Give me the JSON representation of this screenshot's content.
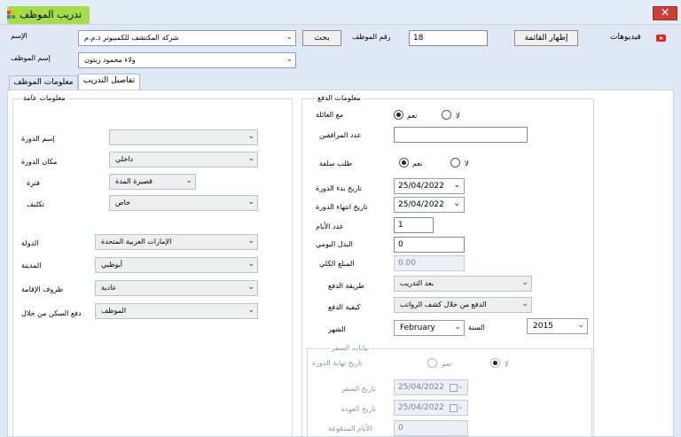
{
  "window": {
    "title": "تدريب الموظف",
    "close_label": "✕"
  },
  "header": {
    "name_label": "الإسم",
    "company_value": "شركة المكتشف للكمبيوتر ذ.م.م",
    "search_label": "بحث",
    "employee_no_label": "رقم الموظف",
    "employee_no_value": "18",
    "show_list_label": "إظهار القائمة",
    "videos_label": "فيديوهات",
    "employee_name_label": "إسم الموظف",
    "employee_name_value": "ولاء محمود زيتون"
  },
  "tabs": [
    {
      "label": "معلومات الموظف",
      "active": false
    },
    {
      "label": "تفاصيل التدريب",
      "active": true
    }
  ],
  "general": {
    "title": "معلومات عامة",
    "course_name_label": "إسم الدورة",
    "course_name_value": "",
    "course_place_label": "مكان الدورة",
    "course_place_value": "داخلي",
    "period_label": "فترة",
    "period_value": "قصيرة المدة",
    "assignment_label": "تكليف",
    "assignment_value": "خاص",
    "country_label": "الدولة",
    "country_value": "الإمارات العربية المتحدة",
    "city_label": "المدينة",
    "city_value": "أبوظبي",
    "residence_label": "ظروف الإقامة",
    "residence_value": "عادية",
    "housing_pay_label": "دفع السكن من خلال",
    "housing_pay_value": "الموظف"
  },
  "payment": {
    "title": "معلومات الدفع",
    "with_family_label": "مع العائلة",
    "yes_label": "نعم",
    "no_label": "لا",
    "companions_label": "عدد المرافقين",
    "companions_value": "",
    "advance_label": "طلب سلفة",
    "start_date_label": "تاريخ بدء الدورة",
    "start_date_value": "25/04/2022",
    "end_date_label": "تاريخ انتهاء الدورة",
    "end_date_value": "25/04/2022",
    "days_label": "عدد الأيام",
    "days_value": "1",
    "daily_allowance_label": "البدل اليومي",
    "daily_allowance_value": "0",
    "total_label": "المبلغ الكلي",
    "total_value": "0.00",
    "payment_method_label": "طريقة الدفع",
    "payment_method_value": "بعد التدريب",
    "payment_how_label": "كيفية الدفع",
    "payment_how_value": "الدفع من خلال كشف الرواتب",
    "month_label": "الشهر",
    "month_value": "February",
    "year_label": "السنة",
    "year_value": "2015"
  },
  "travel": {
    "title": "بيانات السفر",
    "course_end_date_label": "تاريخ نهاية الدورة",
    "yes_label": "نعم",
    "no_label": "لا",
    "travel_date_label": "تاريخ السفر",
    "travel_date_value": "25/04/2022",
    "return_date_label": "تاريخ العودة",
    "return_date_value": "25/04/2022",
    "paid_days_label": "الأيام المدفوعة",
    "paid_days_value": "0"
  },
  "icons": {
    "dropdown": "chevron-down-icon",
    "close": "close-icon",
    "video": "youtube-icon",
    "app": "app-icon"
  },
  "colors": {
    "title_highlight": "#a6dc4a",
    "close_button": "#c9403a",
    "window_bg": "#dfe8f4"
  }
}
